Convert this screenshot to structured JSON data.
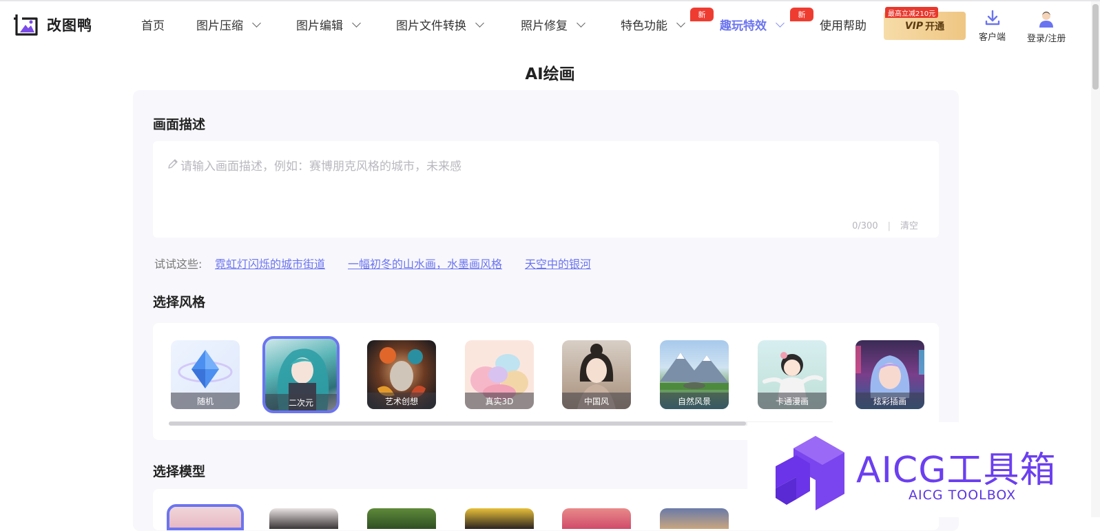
{
  "app": {
    "name": "改图鸭"
  },
  "nav": {
    "home": "首页",
    "compress": "图片压缩",
    "edit": "图片编辑",
    "convert": "图片文件转换",
    "repair": "照片修复",
    "special": "特色功能",
    "fun": "趣玩特效",
    "help": "使用帮助",
    "new_badge": "新"
  },
  "vip": {
    "promo": "最高立减210元",
    "label_italic": "VIP",
    "label": "开通"
  },
  "tools": {
    "client": "客户端",
    "login": "登录/注册"
  },
  "page": {
    "title": "AI绘画"
  },
  "description": {
    "title": "画面描述",
    "placeholder": "请输入画面描述，例如：赛博朋克风格的城市，未来感",
    "counter": "0/300",
    "clear": "清空"
  },
  "suggestions": {
    "label": "试试这些:",
    "items": [
      "霓虹灯闪烁的城市街道",
      "一幅初冬的山水画，水墨画风格",
      "天空中的银河"
    ]
  },
  "styles": {
    "title": "选择风格",
    "items": [
      {
        "label": "随机",
        "selected": false
      },
      {
        "label": "二次元",
        "selected": true
      },
      {
        "label": "艺术创想",
        "selected": false
      },
      {
        "label": "真实3D",
        "selected": false
      },
      {
        "label": "中国风",
        "selected": false
      },
      {
        "label": "自然风景",
        "selected": false
      },
      {
        "label": "卡通漫画",
        "selected": false
      },
      {
        "label": "炫彩插画",
        "selected": false
      }
    ]
  },
  "models": {
    "title": "选择模型"
  },
  "watermark": {
    "title": "AICG工具箱",
    "subtitle": "AICG TOOLBOX"
  },
  "colors": {
    "accent": "#6b74f0",
    "badge": "#ef3c31",
    "vip_gold": "#efc683",
    "watermark": "#6b3ff0"
  }
}
